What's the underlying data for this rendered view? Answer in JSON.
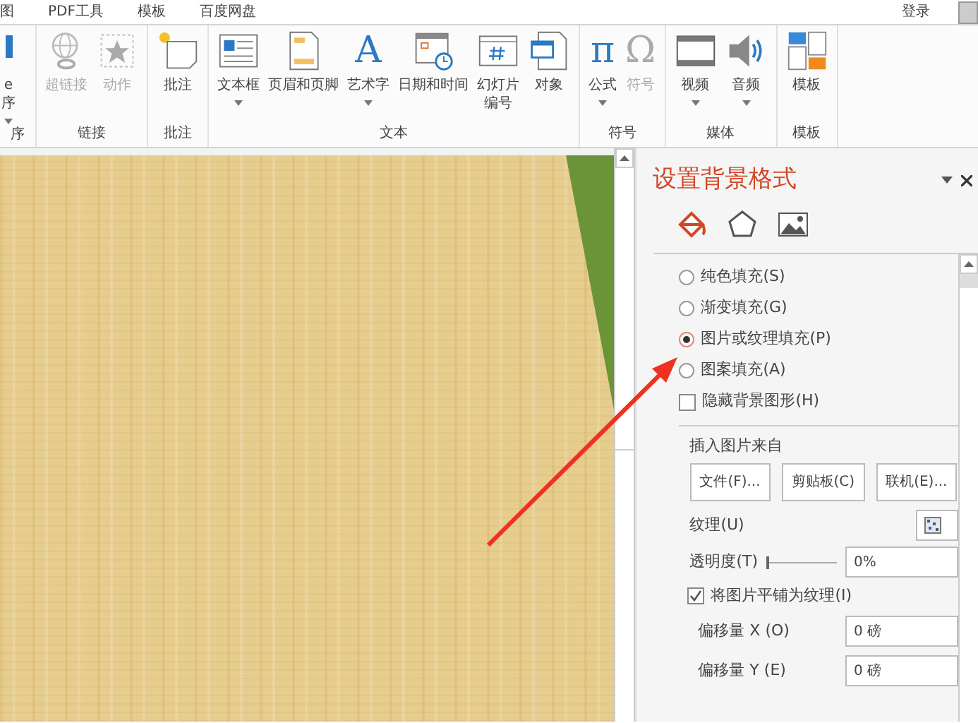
{
  "menu_bar": {
    "items": [
      "图",
      "PDF工具",
      "模板",
      "百度网盘"
    ],
    "login": "登录"
  },
  "ribbon": {
    "groups": [
      {
        "label": "序",
        "buttons": [
          {
            "lines": [
              "e",
              "序"
            ],
            "dropdown": true,
            "disabled": false
          }
        ]
      },
      {
        "label": "链接",
        "buttons": [
          {
            "lines": [
              "超链接"
            ],
            "dropdown": false,
            "disabled": true
          },
          {
            "lines": [
              "动作"
            ],
            "dropdown": false,
            "disabled": true
          }
        ]
      },
      {
        "label": "批注",
        "buttons": [
          {
            "lines": [
              "批注"
            ],
            "dropdown": false,
            "disabled": false
          }
        ]
      },
      {
        "label": "文本",
        "buttons": [
          {
            "lines": [
              "文本框"
            ],
            "dropdown": true,
            "disabled": false
          },
          {
            "lines": [
              "页眉和页脚"
            ],
            "dropdown": false,
            "disabled": false
          },
          {
            "lines": [
              "艺术字"
            ],
            "dropdown": true,
            "disabled": false,
            "glyph": "A"
          },
          {
            "lines": [
              "日期和时间"
            ],
            "dropdown": false,
            "disabled": false
          },
          {
            "lines": [
              "幻灯片",
              "编号"
            ],
            "dropdown": false,
            "disabled": false
          },
          {
            "lines": [
              "对象"
            ],
            "dropdown": false,
            "disabled": false
          }
        ]
      },
      {
        "label": "符号",
        "buttons": [
          {
            "lines": [
              "公式"
            ],
            "dropdown": true,
            "disabled": false,
            "glyph": "π"
          },
          {
            "lines": [
              "符号"
            ],
            "dropdown": false,
            "disabled": true,
            "glyph": "Ω"
          }
        ]
      },
      {
        "label": "媒体",
        "buttons": [
          {
            "lines": [
              "视频"
            ],
            "dropdown": true,
            "disabled": false
          },
          {
            "lines": [
              "音频"
            ],
            "dropdown": true,
            "disabled": false
          }
        ]
      },
      {
        "label": "模板",
        "buttons": [
          {
            "lines": [
              "模板"
            ],
            "dropdown": false,
            "disabled": false
          }
        ]
      }
    ]
  },
  "panel": {
    "title": "设置背景格式",
    "tabs": [
      {
        "selected": true
      },
      {
        "selected": false
      },
      {
        "selected": false
      }
    ],
    "fill_options": [
      {
        "label": "纯色填充(S)",
        "selected": false
      },
      {
        "label": "渐变填充(G)",
        "selected": false
      },
      {
        "label": "图片或纹理填充(P)",
        "selected": true
      },
      {
        "label": "图案填充(A)",
        "selected": false
      }
    ],
    "hide_background": {
      "label": "隐藏背景图形(H)",
      "checked": false
    },
    "insert_from": {
      "label": "插入图片来自",
      "buttons": [
        "文件(F)...",
        "剪贴板(C)",
        "联机(E)..."
      ]
    },
    "texture": {
      "label": "纹理(U)"
    },
    "transparency": {
      "label": "透明度(T)",
      "level": 0,
      "value": "0%"
    },
    "tile": {
      "label": "将图片平铺为纹理(I)",
      "checked": true
    },
    "offsets": [
      {
        "label": "偏移量 X (O)",
        "value": "0 磅"
      },
      {
        "label": "偏移量 Y (E)",
        "value": "0 磅"
      }
    ]
  }
}
